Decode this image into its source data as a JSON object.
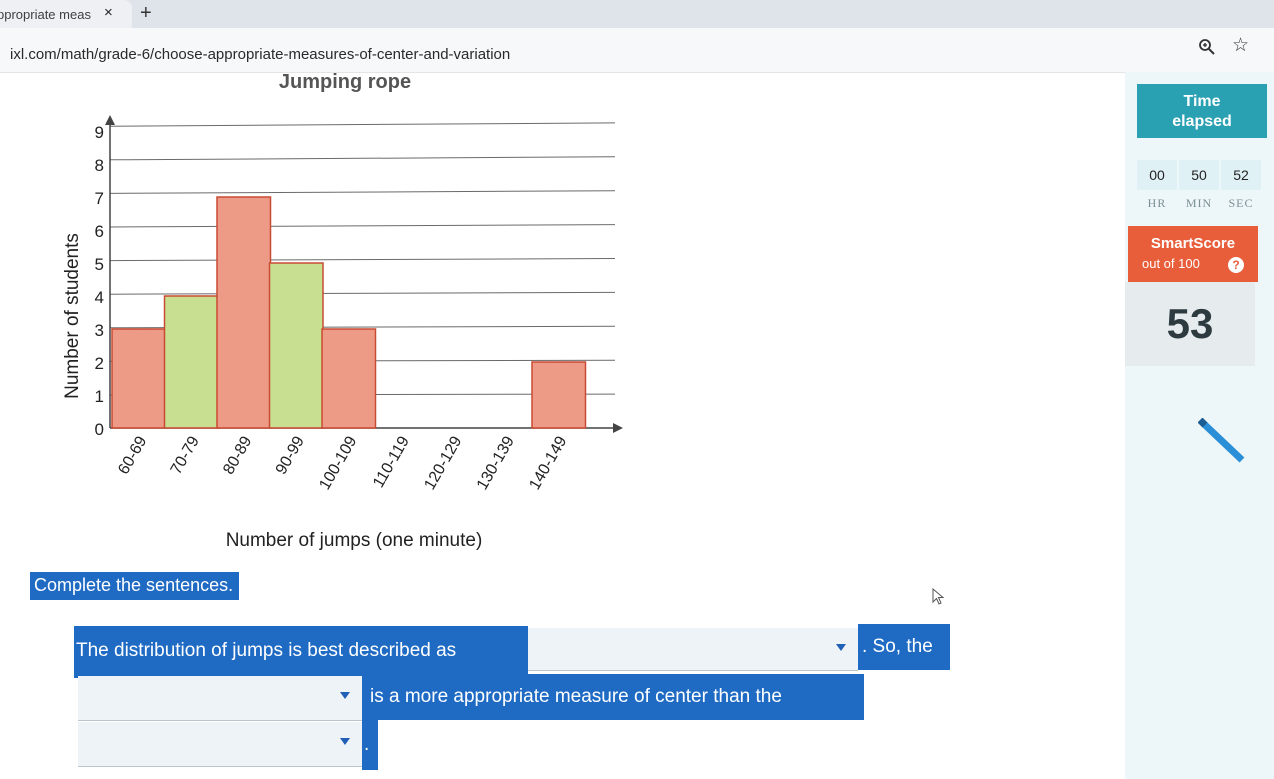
{
  "browser": {
    "tab_title": "ppropriate meas",
    "tab_close": "×",
    "new_tab": "+",
    "url": "ixl.com/math/grade-6/choose-appropriate-measures-of-center-and-variation",
    "icons": [
      "zoom-icon",
      "star-icon"
    ]
  },
  "chart_data": {
    "type": "bar",
    "title": "Jumping rope",
    "xlabel": "Number of jumps (one minute)",
    "ylabel": "Number of students",
    "categories": [
      "60-69",
      "70-79",
      "80-89",
      "90-99",
      "100-109",
      "110-119",
      "120-129",
      "130-139",
      "140-149"
    ],
    "values": [
      3,
      4,
      7,
      5,
      3,
      0,
      0,
      0,
      2
    ],
    "bar_colors": [
      "#ed9a86",
      "#c8de91",
      "#ed9a86",
      "#c8de91",
      "#ed9a86",
      "#ed9a86",
      "#ed9a86",
      "#ed9a86",
      "#ed9a86"
    ],
    "ylim": [
      0,
      9
    ],
    "yticks": [
      "0",
      "1",
      "2",
      "3",
      "4",
      "5",
      "6",
      "7",
      "8",
      "9"
    ],
    "grid": true
  },
  "timer": {
    "label_line1": "Time",
    "label_line2": "elapsed",
    "hr": "00",
    "min": "50",
    "sec": "52",
    "hr_label": "HR",
    "min_label": "MIN",
    "sec_label": "SEC",
    "color": "#2aa0b3"
  },
  "smartscore": {
    "title": "SmartScore",
    "subtitle": "out of 100",
    "help": "?",
    "value": "53",
    "color": "#e85d3a"
  },
  "question": {
    "instruction": "Complete the sentences.",
    "sentence_part1": "The distribution of jumps is best described as",
    "sentence_part2": ". So, the",
    "sentence_part3": "is a more appropriate measure of center than the",
    "sentence_part4": ".",
    "dropdown1_value": "",
    "dropdown2_value": "",
    "dropdown3_value": "",
    "highlight_color": "#1f6bc4"
  }
}
